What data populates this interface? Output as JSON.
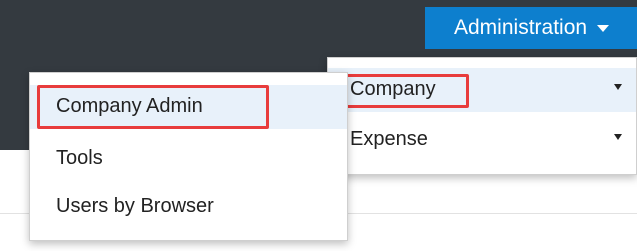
{
  "header": {
    "admin_menu_label": "Administration"
  },
  "admin_menu": {
    "items": [
      {
        "label": "Company"
      },
      {
        "label": "Expense"
      }
    ]
  },
  "company_submenu": {
    "items": [
      {
        "label": "Company Admin"
      },
      {
        "label": "Tools"
      },
      {
        "label": "Users by Browser"
      }
    ]
  },
  "colors": {
    "topbar": "#343a40",
    "accent_button": "#0d7fce",
    "highlight_border": "#e83c3c",
    "hover_background": "#e8f1fa"
  },
  "icons": {
    "admin_caret": "caret-down-icon",
    "submenu_arrow": "triangle-down-icon"
  }
}
